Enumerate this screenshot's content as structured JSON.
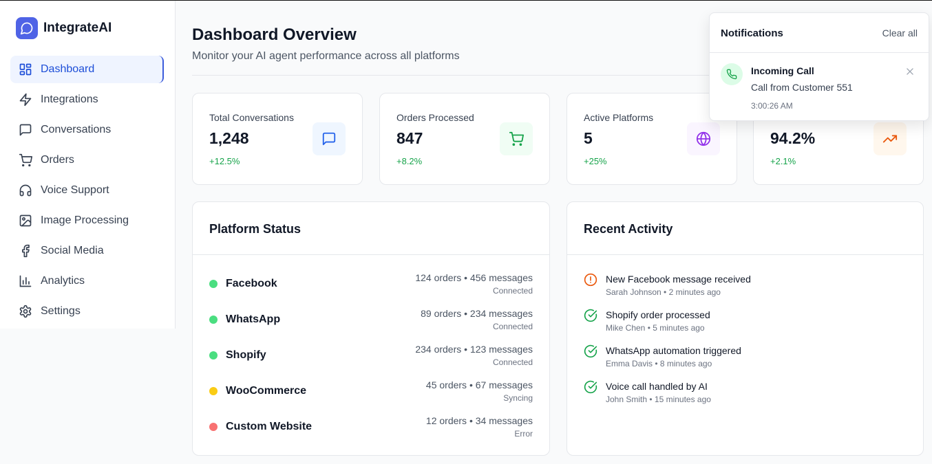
{
  "app": {
    "name": "IntegrateAI"
  },
  "sidebar": {
    "items": [
      {
        "label": "Dashboard",
        "icon": "dashboard-grid-icon",
        "active": true
      },
      {
        "label": "Integrations",
        "icon": "lightning-icon"
      },
      {
        "label": "Conversations",
        "icon": "message-square-icon"
      },
      {
        "label": "Orders",
        "icon": "shopping-cart-icon"
      },
      {
        "label": "Voice Support",
        "icon": "headphones-icon"
      },
      {
        "label": "Image Processing",
        "icon": "image-icon"
      },
      {
        "label": "Social Media",
        "icon": "facebook-icon"
      },
      {
        "label": "Analytics",
        "icon": "bar-chart-icon"
      },
      {
        "label": "Settings",
        "icon": "gear-icon"
      }
    ]
  },
  "header": {
    "title": "Dashboard Overview",
    "subtitle": "Monitor your AI agent performance across all platforms"
  },
  "stats": [
    {
      "label": "Total Conversations",
      "value": "1,248",
      "change": "+12.5%",
      "icon": "message-square-icon",
      "icon_bg": "#eff6ff",
      "icon_color": "#2563eb"
    },
    {
      "label": "Orders Processed",
      "value": "847",
      "change": "+8.2%",
      "icon": "shopping-cart-icon",
      "icon_bg": "#f0fdf4",
      "icon_color": "#16a34a"
    },
    {
      "label": "Active Platforms",
      "value": "5",
      "change": "+25%",
      "icon": "globe-icon",
      "icon_bg": "#faf5ff",
      "icon_color": "#9333ea"
    },
    {
      "label": "",
      "value": "94.2%",
      "change": "+2.1%",
      "icon": "trending-up-icon",
      "icon_bg": "#fff7ed",
      "icon_color": "#ea580c"
    }
  ],
  "platform_status": {
    "title": "Platform Status",
    "platforms": [
      {
        "name": "Facebook",
        "stats": "124 orders • 456 messages",
        "status": "Connected",
        "color": "#4ade80"
      },
      {
        "name": "WhatsApp",
        "stats": "89 orders • 234 messages",
        "status": "Connected",
        "color": "#4ade80"
      },
      {
        "name": "Shopify",
        "stats": "234 orders • 123 messages",
        "status": "Connected",
        "color": "#4ade80"
      },
      {
        "name": "WooCommerce",
        "stats": "45 orders • 67 messages",
        "status": "Syncing",
        "color": "#facc15"
      },
      {
        "name": "Custom Website",
        "stats": "12 orders • 34 messages",
        "status": "Error",
        "color": "#f87171"
      }
    ]
  },
  "recent_activity": {
    "title": "Recent Activity",
    "items": [
      {
        "title": "New Facebook message received",
        "meta": "Sarah Johnson • 2 minutes ago",
        "icon": "alert-circle-icon",
        "color": "#ea580c"
      },
      {
        "title": "Shopify order processed",
        "meta": "Mike Chen • 5 minutes ago",
        "icon": "check-circle-icon",
        "color": "#16a34a"
      },
      {
        "title": "WhatsApp automation triggered",
        "meta": "Emma Davis • 8 minutes ago",
        "icon": "check-circle-icon",
        "color": "#16a34a"
      },
      {
        "title": "Voice call handled by AI",
        "meta": "John Smith • 15 minutes ago",
        "icon": "check-circle-icon",
        "color": "#16a34a"
      }
    ]
  },
  "notifications": {
    "title": "Notifications",
    "clear_label": "Clear all",
    "item": {
      "title": "Incoming Call",
      "text": "Call from Customer 551",
      "time": "3:00:26 AM",
      "icon": "phone-icon"
    }
  }
}
